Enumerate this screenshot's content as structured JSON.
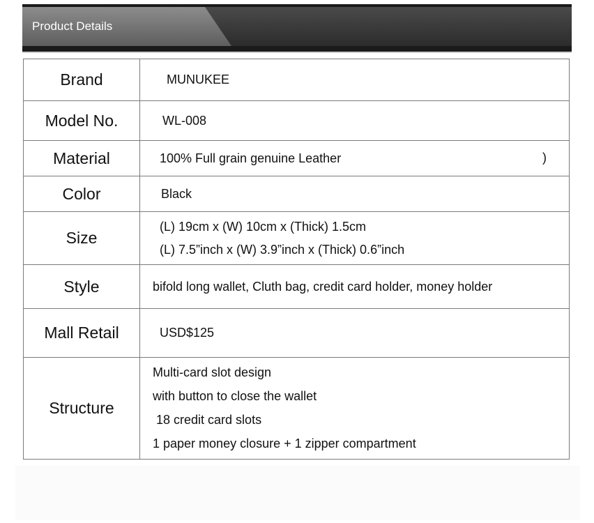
{
  "header": {
    "title": "Product Details"
  },
  "rows": [
    {
      "label": "Brand",
      "lines": [
        "MUNUKEE"
      ]
    },
    {
      "label": "Model No.",
      "lines": [
        "WL-008"
      ]
    },
    {
      "label": "Material",
      "lines": [
        "100%  Full grain genuine Leather",
        ")"
      ]
    },
    {
      "label": "Color",
      "lines": [
        "Black"
      ]
    },
    {
      "label": "Size",
      "lines": [
        "(L) 19cm x (W) 10cm x (Thick) 1.5cm",
        "(L) 7.5”inch x (W) 3.9”inch x (Thick) 0.6”inch"
      ]
    },
    {
      "label": "Style",
      "lines": [
        "bifold long wallet, Cluth bag, credit card holder, money holder"
      ]
    },
    {
      "label": "Mall Retail",
      "lines": [
        "USD$125"
      ]
    },
    {
      "label": "Structure",
      "lines": [
        "Multi-card slot design",
        "with button to close the wallet",
        " 18 credit card slots",
        "1 paper money closure + 1 zipper compartment"
      ]
    }
  ]
}
